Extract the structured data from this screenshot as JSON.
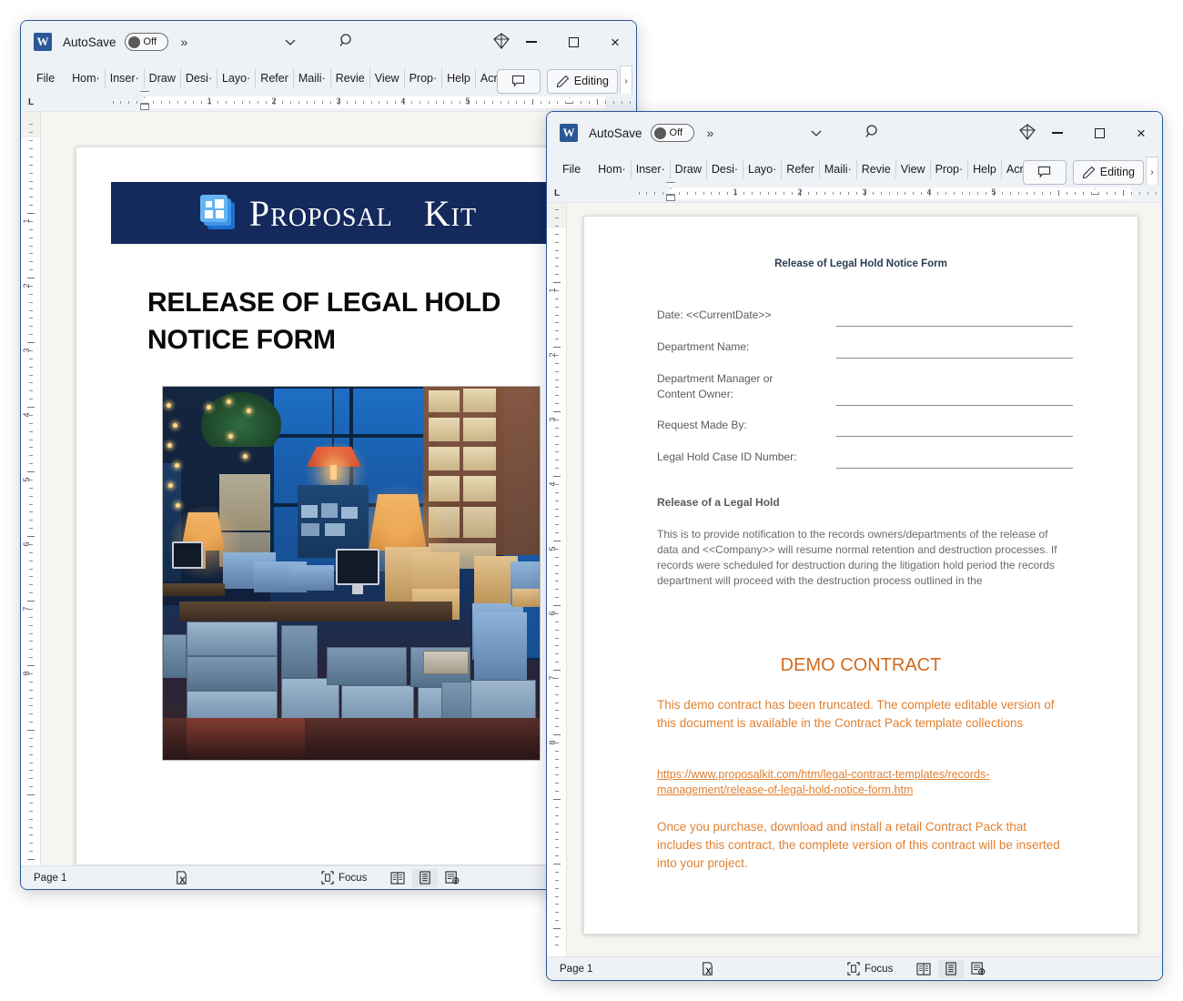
{
  "app": {
    "name": "Microsoft Word",
    "word_icon_letter": "W",
    "autosave_label": "AutoSave",
    "autosave_state": "Off",
    "overflow_chevron": "»",
    "qat_chevron_icon": "chevron-down-icon",
    "search_icon": "search-icon",
    "diamond_icon": "diamond-icon",
    "minimize_icon": "minimize-icon",
    "maximize_icon": "maximize-icon",
    "close_icon": "close-icon",
    "close_glyph": "×"
  },
  "ribbon": {
    "tabs": [
      "File",
      "Hom·",
      "Inser·",
      "Draw",
      "Desi·",
      "Layo·",
      "Refer",
      "Maili·",
      "Revie",
      "View",
      "Prop·",
      "Help",
      "Acro·"
    ],
    "comment_button_label": "",
    "comment_icon": "comment-icon",
    "editing_button_label": "Editing",
    "editing_icon": "pencil-icon",
    "overflow_glyph": "›"
  },
  "ruler": {
    "tabstop_marker": "L",
    "h_numbers": [
      "1",
      "2",
      "3",
      "4",
      "5"
    ],
    "v_numbers": [
      "1",
      "2",
      "3",
      "4",
      "5",
      "6",
      "7",
      "8"
    ]
  },
  "status": {
    "page_label": "Page 1",
    "accessibility_icon": "accessibility-checker-icon",
    "focus_label": "Focus",
    "focus_icon": "focus-icon",
    "view_read_icon": "read-mode-icon",
    "view_print_icon": "print-layout-icon",
    "view_web_icon": "web-layout-icon"
  },
  "colors": {
    "banner_navy": "#14295c",
    "demo_orange": "#d2691e",
    "body_orange": "#e08030",
    "heading_gray": "#5b5b5b",
    "title_blue": "#2b3a55",
    "word_blue": "#2b5797"
  },
  "doc1": {
    "brand_icon": "proposal-kit-logo-icon",
    "brand_word_1": "Proposal",
    "brand_word_2": "Kit",
    "title_line1": "RELEASE OF LEGAL HOLD",
    "title_line2": "NOTICE FORM",
    "photo_alt": "records-archive-room-photo"
  },
  "doc2": {
    "heading": "Release of Legal Hold Notice Form",
    "fields": [
      {
        "label": "Date: <<CurrentDate>>",
        "value": ""
      },
      {
        "label": "Department Name:",
        "value": ""
      },
      {
        "label": "Department Manager or\nContent Owner:",
        "value": ""
      },
      {
        "label": "Request Made By:",
        "value": ""
      },
      {
        "label": "Legal Hold Case ID Number:",
        "value": ""
      }
    ],
    "field_labels": [
      "Date: <<CurrentDate>>",
      "Department Name:",
      "Department Manager or",
      "Content Owner:",
      "Request Made By:",
      "Legal Hold Case ID Number:"
    ],
    "section_heading": "Release of a Legal Hold",
    "body_paragraph": "This is to provide notification to the records owners/departments of the release of data and <<Company>> will resume normal retention and destruction processes.  If records were scheduled for destruction during the litigation hold period the records department will proceed with the destruction process outlined in the",
    "demo_heading": "DEMO CONTRACT",
    "demo_paragraph": "This demo contract has been truncated. The complete editable version of this document is available in the Contract Pack template collections",
    "demo_url": "https://www.proposalkit.com/htm/legal-contract-templates/records-management/release-of-legal-hold-notice-form.htm",
    "closing_paragraph": "Once you purchase, download and install a retail Contract Pack that includes this contract, the complete version of this contract will be inserted into your project."
  }
}
